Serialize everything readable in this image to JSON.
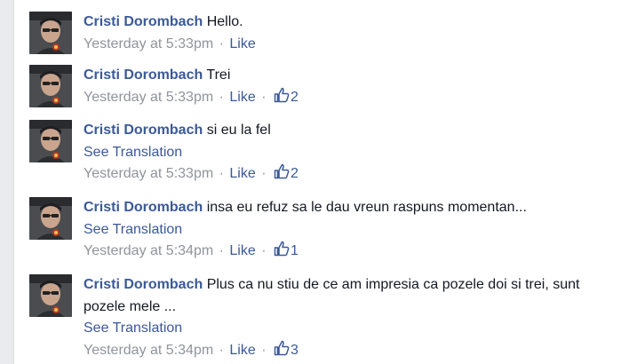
{
  "comments": [
    {
      "author": "Cristi Dorombach",
      "text": "Hello.",
      "see_translation": "",
      "timestamp": "Yesterday at 5:33pm",
      "like_label": "Like",
      "separator": "·",
      "likes_count": ""
    },
    {
      "author": "Cristi Dorombach",
      "text": "Trei",
      "see_translation": "",
      "timestamp": "Yesterday at 5:33pm",
      "like_label": "Like",
      "separator": "·",
      "likes_count": "2"
    },
    {
      "author": "Cristi Dorombach",
      "text": "si eu la fel",
      "see_translation": "See Translation",
      "timestamp": "Yesterday at 5:33pm",
      "like_label": "Like",
      "separator": "·",
      "likes_count": "2"
    },
    {
      "author": "Cristi Dorombach",
      "text": "insa eu refuz sa le dau vreun raspuns momentan...",
      "see_translation": "See Translation",
      "timestamp": "Yesterday at 5:34pm",
      "like_label": "Like",
      "separator": "·",
      "likes_count": "1"
    },
    {
      "author": "Cristi Dorombach",
      "text": "Plus ca nu stiu de ce am impresia ca pozele doi si trei, sunt pozele mele ...",
      "see_translation": "See Translation",
      "timestamp": "Yesterday at 5:34pm",
      "like_label": "Like",
      "separator": "·",
      "likes_count": "3"
    }
  ],
  "colors": {
    "link": "#3b5998",
    "meta": "#90949c",
    "text": "#141823"
  },
  "icons": {
    "like_count": "thumbs-up-icon",
    "avatar": "user-photo"
  }
}
